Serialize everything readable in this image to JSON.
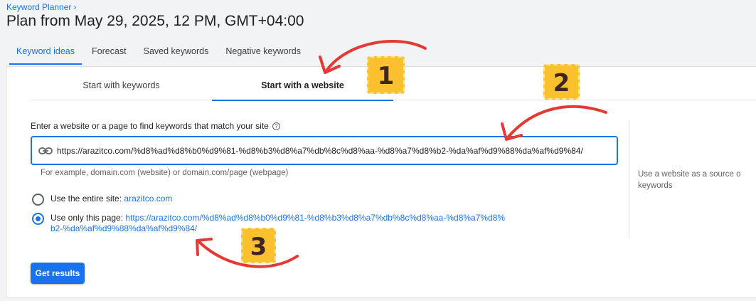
{
  "header": {
    "breadcrumb": "Keyword Planner",
    "title": "Plan from May 29, 2025, 12 PM, GMT+04:00"
  },
  "top_tabs": [
    {
      "label": "Keyword ideas",
      "active": true
    },
    {
      "label": "Forecast",
      "active": false
    },
    {
      "label": "Saved keywords",
      "active": false
    },
    {
      "label": "Negative keywords",
      "active": false
    }
  ],
  "mode_tabs": [
    {
      "label": "Start with keywords",
      "active": false
    },
    {
      "label": "Start with a website",
      "active": true
    }
  ],
  "form": {
    "label": "Enter a website or a page to find keywords that match your site",
    "help_icon": "help-icon",
    "url_value": "https://arazitco.com/%d8%ad%d8%b0%d9%81-%d8%b3%d8%a7%db%8c%d8%aa-%d8%a7%d8%b2-%da%af%d9%88%da%af%d9%84/",
    "hint": "For example, domain.com (website) or domain.com/page (webpage)",
    "options": [
      {
        "label": "Use the entire site:",
        "link": "arazitco.com",
        "selected": false
      },
      {
        "label": "Use only this page:",
        "link": "https://arazitco.com/%d8%ad%d8%b0%d9%81-%d8%b3%d8%a7%db%8c%d8%aa-%d8%a7%d8%b2-%da%af%d9%88%da%af%d9%84/",
        "selected": true
      }
    ],
    "submit_label": "Get results"
  },
  "side_panel": {
    "line1": "Use a website as a source o",
    "line2": "keywords"
  },
  "annotations": {
    "badges": [
      "1",
      "2",
      "3"
    ],
    "badge_color": "#fbc02d",
    "arrow_color": "#e53935"
  },
  "colors": {
    "accent": "#1a73e8",
    "text": "#202124",
    "muted": "#5f6368"
  }
}
